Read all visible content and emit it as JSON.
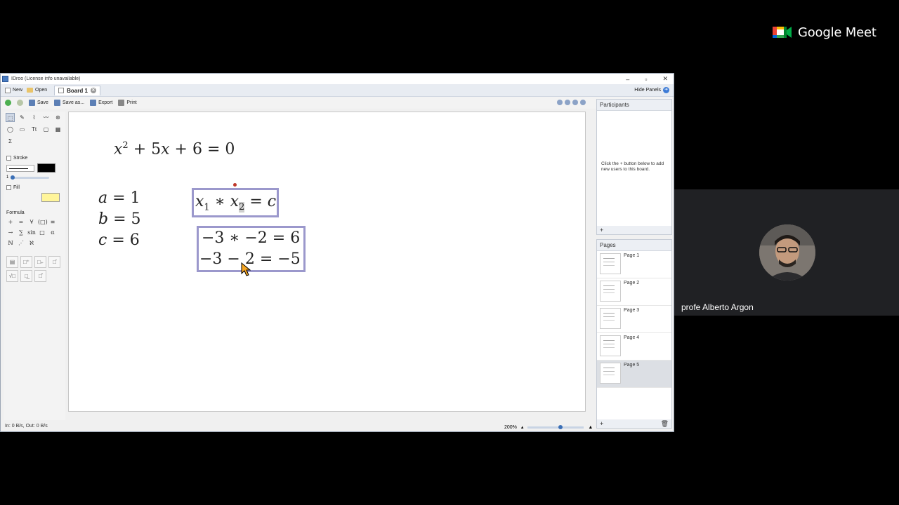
{
  "meet": {
    "brand": "Google Meet",
    "participant_name": "profe Alberto Argon"
  },
  "window": {
    "title": "IDroo (License info unavailable)",
    "controls": {
      "minimize": "–",
      "maximize": "▫",
      "close": "✕"
    }
  },
  "tabbar": {
    "new_label": "New",
    "open_label": "Open",
    "board_tab": "Board 1",
    "hide_panels": "Hide Panels"
  },
  "toolbar": {
    "save": "Save",
    "save_as": "Save as...",
    "export": "Export",
    "print": "Print"
  },
  "tools": {
    "stroke_label": "Stroke",
    "stroke_width": "1",
    "fill_label": "Fill",
    "formula_label": "Formula",
    "shape_glyphs": [
      "⬚",
      "✎",
      "⌇",
      "〰",
      "⊛",
      "◯",
      "▭",
      "Tt",
      "▢",
      "▦"
    ],
    "sigma": "Σ",
    "formula_glyphs": [
      "+",
      "=",
      "∀",
      "(□)",
      "≡",
      "→",
      "∑",
      "sin",
      "□",
      "α",
      "ℕ",
      "⋰",
      "ℵ"
    ],
    "template_glyphs": [
      "▤",
      "□⁺",
      "□₊",
      "□̄",
      "√□",
      "□̲",
      "□̂"
    ]
  },
  "canvas": {
    "eq_main": {
      "x": "x",
      "sup": "2",
      "rest": " + 5",
      "x2": "x",
      "tail": " + 6 = 0"
    },
    "a_line": {
      "var": "a",
      "rest": " = 1"
    },
    "b_line": {
      "var": "b",
      "rest": " = 5"
    },
    "c_line": {
      "var": "c",
      "rest": " = 6"
    },
    "product": {
      "x1": "x",
      "s1": "1",
      "op": " ∗ ",
      "x2": "x",
      "s2": "2",
      "eq": " = ",
      "c": "c"
    },
    "calc_1": "−3 ∗ −2 = 6",
    "calc_2": "−3 − 2 = −5"
  },
  "status": {
    "traffic": "In: 0 B/s, Out: 0 B/s",
    "zoom": "200%"
  },
  "participants_panel": {
    "title": "Participants",
    "hint": "Click the + button below to add new users to this board.",
    "add": "+"
  },
  "pages_panel": {
    "title": "Pages",
    "pages": [
      "Page 1",
      "Page 2",
      "Page 3",
      "Page 4",
      "Page 5"
    ],
    "selected": "Page 5",
    "add": "+",
    "delete": "🗑"
  },
  "colors": {
    "frame": "#9b98cc",
    "fill_swatch": "#fff59a",
    "stroke_swatch": "#000000"
  }
}
